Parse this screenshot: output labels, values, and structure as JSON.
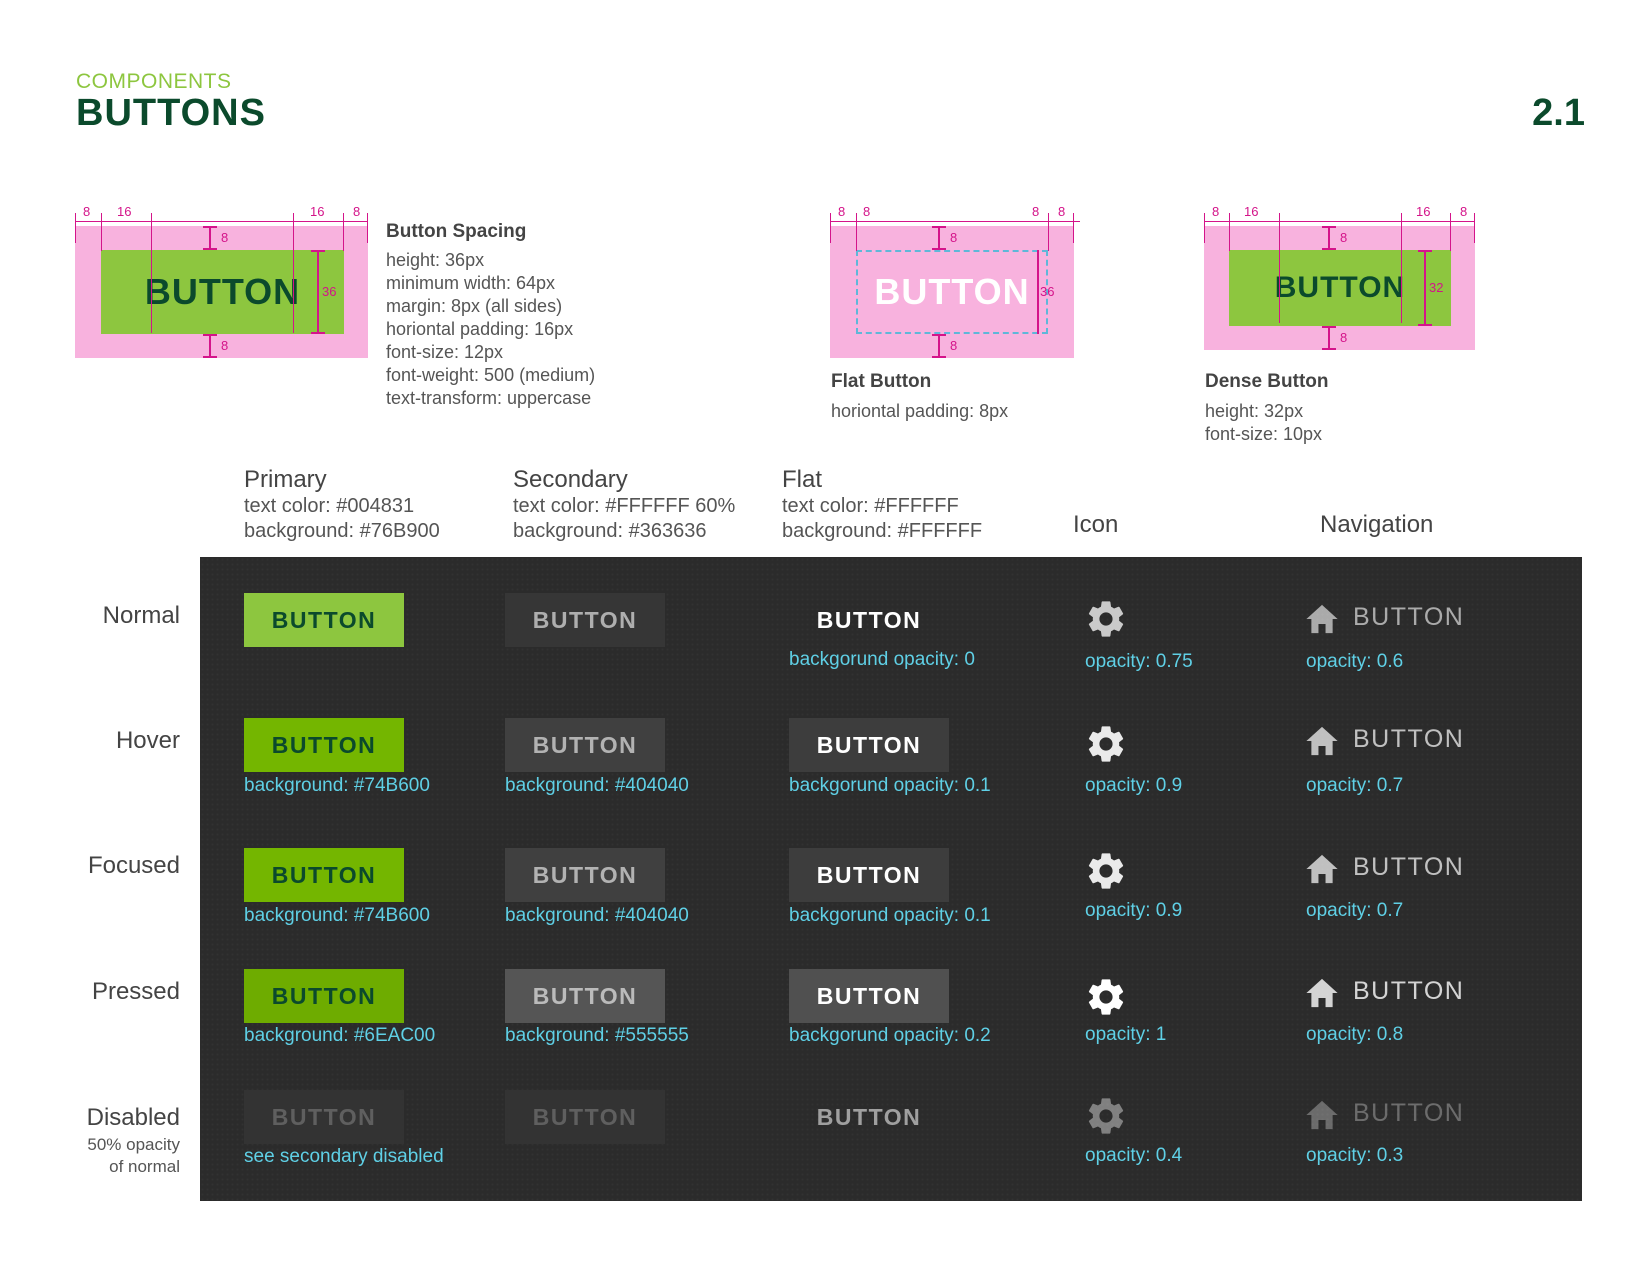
{
  "header": {
    "section": "COMPONENTS",
    "title": "BUTTONS",
    "page_number": "2.1"
  },
  "spacing": {
    "button_demo_label": "BUTTON",
    "diagram1": {
      "left_margin": "8",
      "left_padding": "16",
      "right_padding": "16",
      "right_margin": "8",
      "top": "8",
      "bottom": "8",
      "height": "36"
    },
    "diagram2": {
      "left_margin": "8",
      "left_padding": "8",
      "right_padding": "8",
      "right_margin": "8",
      "top": "8",
      "bottom": "8",
      "height": "36"
    },
    "diagram3": {
      "left_margin": "8",
      "left_padding": "16",
      "right_padding": "16",
      "right_margin": "8",
      "top": "8",
      "bottom": "8",
      "height": "32"
    },
    "button_spacing": {
      "title": "Button Spacing",
      "lines": [
        "height: 36px",
        "minimum width: 64px",
        "margin: 8px (all sides)",
        "horiontal padding: 16px",
        "font-size: 12px",
        "font-weight: 500 (medium)",
        "text-transform: uppercase"
      ]
    },
    "flat_button": {
      "title": "Flat Button",
      "lines": [
        "horiontal padding: 8px"
      ]
    },
    "dense_button": {
      "title": "Dense Button",
      "lines": [
        "height: 32px",
        "font-size: 10px"
      ]
    }
  },
  "columns": {
    "primary": {
      "title": "Primary",
      "lines": [
        "text color: #004831",
        "background: #76B900"
      ]
    },
    "secondary": {
      "title": "Secondary",
      "lines": [
        "text color: #FFFFFF 60%",
        "background: #363636"
      ]
    },
    "flat": {
      "title": "Flat",
      "lines": [
        "text color: #FFFFFF",
        "background: #FFFFFF"
      ]
    },
    "icon": {
      "title": "Icon"
    },
    "navigation": {
      "title": "Navigation"
    }
  },
  "button_label": "BUTTON",
  "rows": [
    {
      "state": "Normal",
      "primary_note": "",
      "secondary_note": "",
      "flat_note": "backgorund opacity: 0",
      "icon_note": "opacity: 0.75",
      "icon_opacity": 0.75,
      "nav_label": "BUTTON",
      "nav_note": "opacity: 0.6",
      "nav_opacity": 0.6
    },
    {
      "state": "Hover",
      "primary_note": "background: #74B600",
      "secondary_note": "background: #404040",
      "flat_note": "backgorund opacity: 0.1",
      "icon_note": "opacity: 0.9",
      "icon_opacity": 0.9,
      "nav_label": "BUTTON",
      "nav_note": "opacity: 0.7",
      "nav_opacity": 0.7
    },
    {
      "state": "Focused",
      "primary_note": "background: #74B600",
      "secondary_note": "background: #404040",
      "flat_note": "backgorund opacity: 0.1",
      "icon_note": "opacity: 0.9",
      "icon_opacity": 0.9,
      "nav_label": "BUTTON",
      "nav_note": "opacity: 0.7",
      "nav_opacity": 0.7
    },
    {
      "state": "Pressed",
      "primary_note": "background: #6EAC00",
      "secondary_note": "background: #555555",
      "flat_note": "backgorund opacity: 0.2",
      "icon_note": "opacity: 1",
      "icon_opacity": 1,
      "nav_label": "BUTTON",
      "nav_note": "opacity: 0.8",
      "nav_opacity": 0.8
    },
    {
      "state": "Disabled",
      "state_sub": [
        "50% opacity",
        "of normal"
      ],
      "primary_note": "see secondary disabled",
      "secondary_note": "",
      "flat_note": "",
      "icon_note": "opacity: 0.4",
      "icon_opacity": 0.4,
      "nav_label": "BUTTON",
      "nav_note": "opacity: 0.3",
      "nav_opacity": 0.3
    }
  ],
  "colors": {
    "primary_text": "#004831",
    "primary_bg": "#76B900",
    "secondary_bg": "#363636",
    "hover_primary": "#74B600",
    "pressed_primary": "#6EAC00",
    "hover_secondary": "#404040",
    "pressed_secondary": "#555555"
  }
}
